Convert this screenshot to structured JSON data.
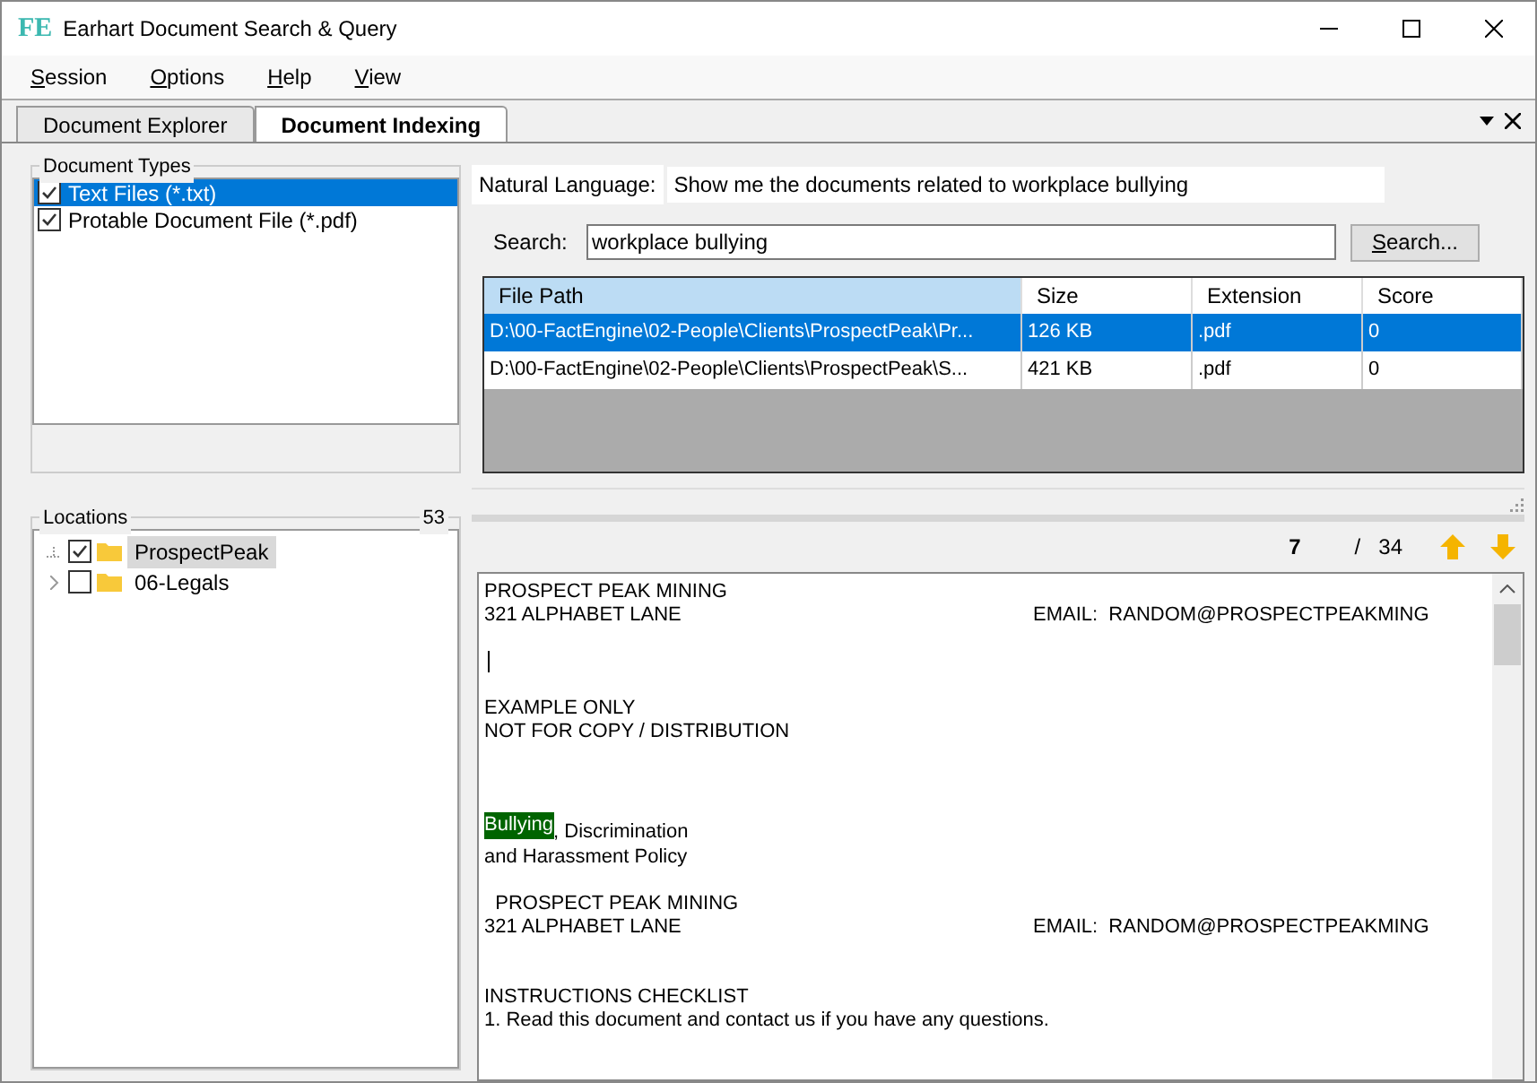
{
  "window": {
    "logo": "FE",
    "title": "Earhart Document Search & Query"
  },
  "menu": [
    {
      "label": "Session"
    },
    {
      "label": "Options"
    },
    {
      "label": "Help"
    },
    {
      "label": "View"
    }
  ],
  "tabs": [
    {
      "label": "Document Explorer",
      "selected": false
    },
    {
      "label": "Document Indexing",
      "selected": true
    }
  ],
  "document_types": {
    "title": "Document Types",
    "items": [
      {
        "label": "Text Files (*.txt)",
        "checked": true,
        "selected": true
      },
      {
        "label": "Protable Document File (*.pdf)",
        "checked": true,
        "selected": false
      }
    ]
  },
  "locations": {
    "title": "Locations",
    "count": "53",
    "items": [
      {
        "label": "ProspectPeak",
        "checked": true,
        "selected": true,
        "expandable": false
      },
      {
        "label": "06-Legals",
        "checked": false,
        "selected": false,
        "expandable": true
      }
    ]
  },
  "natural_language": {
    "label": "Natural Language:",
    "value": "Show me the documents related to workplace bullying"
  },
  "search": {
    "label": "Search:",
    "value": "workplace bullying",
    "button": "Search..."
  },
  "table": {
    "columns": [
      "File Path",
      "Size",
      "Extension",
      "Score"
    ],
    "rows": [
      {
        "cells": [
          "D:\\00-FactEngine\\02-People\\Clients\\ProspectPeak\\Pr...",
          "126 KB",
          ".pdf",
          "0"
        ],
        "selected": true
      },
      {
        "cells": [
          "D:\\00-FactEngine\\02-People\\Clients\\ProspectPeak\\S...",
          "421 KB",
          ".pdf",
          "0"
        ],
        "selected": false
      }
    ]
  },
  "match": {
    "current": "7",
    "separator": "/",
    "total": "34"
  },
  "document": {
    "lines": [
      {
        "kind": "text",
        "text": "PROSPECT PEAK MINING"
      },
      {
        "kind": "text",
        "text": "321 ALPHABET LANE",
        "right": "EMAIL:  RANDOM@PROSPECTPEAKMING"
      },
      {
        "kind": "blank"
      },
      {
        "kind": "caret"
      },
      {
        "kind": "blank"
      },
      {
        "kind": "text",
        "text": "EXAMPLE ONLY"
      },
      {
        "kind": "text",
        "text": "NOT FOR COPY / DISTRIBUTION"
      },
      {
        "kind": "blank"
      },
      {
        "kind": "blank"
      },
      {
        "kind": "blank"
      },
      {
        "kind": "highlight",
        "highlight": "Bullying",
        "text": ", Discrimination"
      },
      {
        "kind": "text",
        "text": "and Harassment Policy"
      },
      {
        "kind": "blank"
      },
      {
        "kind": "text",
        "text": "  PROSPECT PEAK MINING"
      },
      {
        "kind": "text",
        "text": "321 ALPHABET LANE",
        "right": "EMAIL:  RANDOM@PROSPECTPEAKMING"
      },
      {
        "kind": "blank"
      },
      {
        "kind": "blank"
      },
      {
        "kind": "text",
        "text": "INSTRUCTIONS CHECKLIST"
      },
      {
        "kind": "text",
        "text": "1. Read this document and contact us if you have any questions."
      }
    ]
  }
}
